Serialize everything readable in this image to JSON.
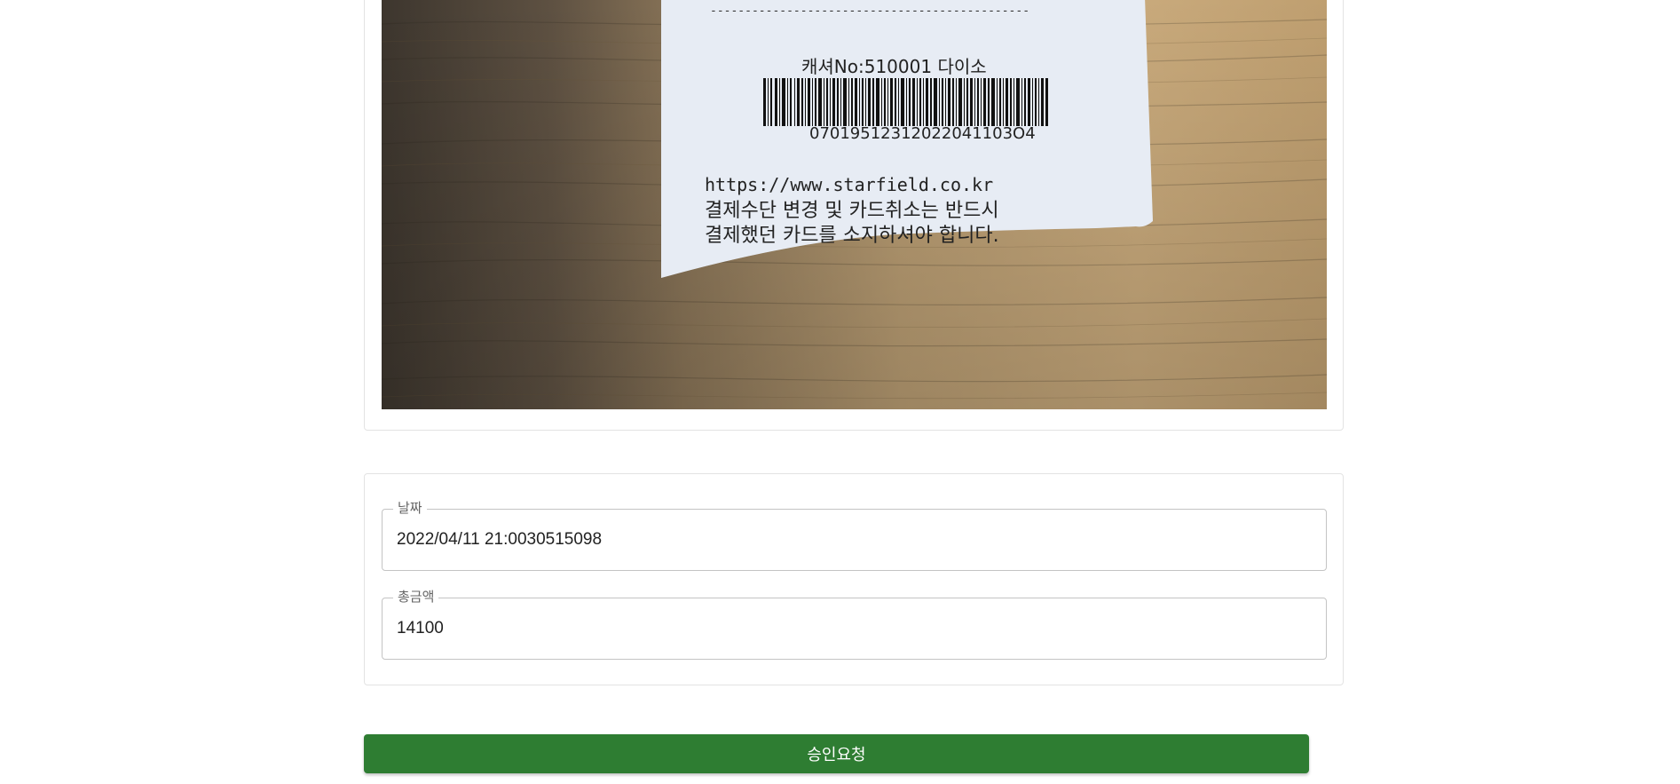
{
  "receipt_photo": {
    "line_top": "----------------------------------------------",
    "cashier_line": "캐셔No:510001 다이소",
    "barcode_number": "07019512312022041103O4",
    "url": "https://www.starfield.co.kr",
    "notice_line1": "결제수단 변경 및 카드취소는 반드시",
    "notice_line2": "결제했던 카드를 소지하셔야 합니다."
  },
  "form": {
    "date": {
      "label": "날짜",
      "value": "2022/04/11 21:0030515098"
    },
    "total": {
      "label": "총금액",
      "value": "14100"
    }
  },
  "submit_label": "승인요청",
  "colors": {
    "button": "#2e7d32",
    "border": "#c4c4c4"
  }
}
